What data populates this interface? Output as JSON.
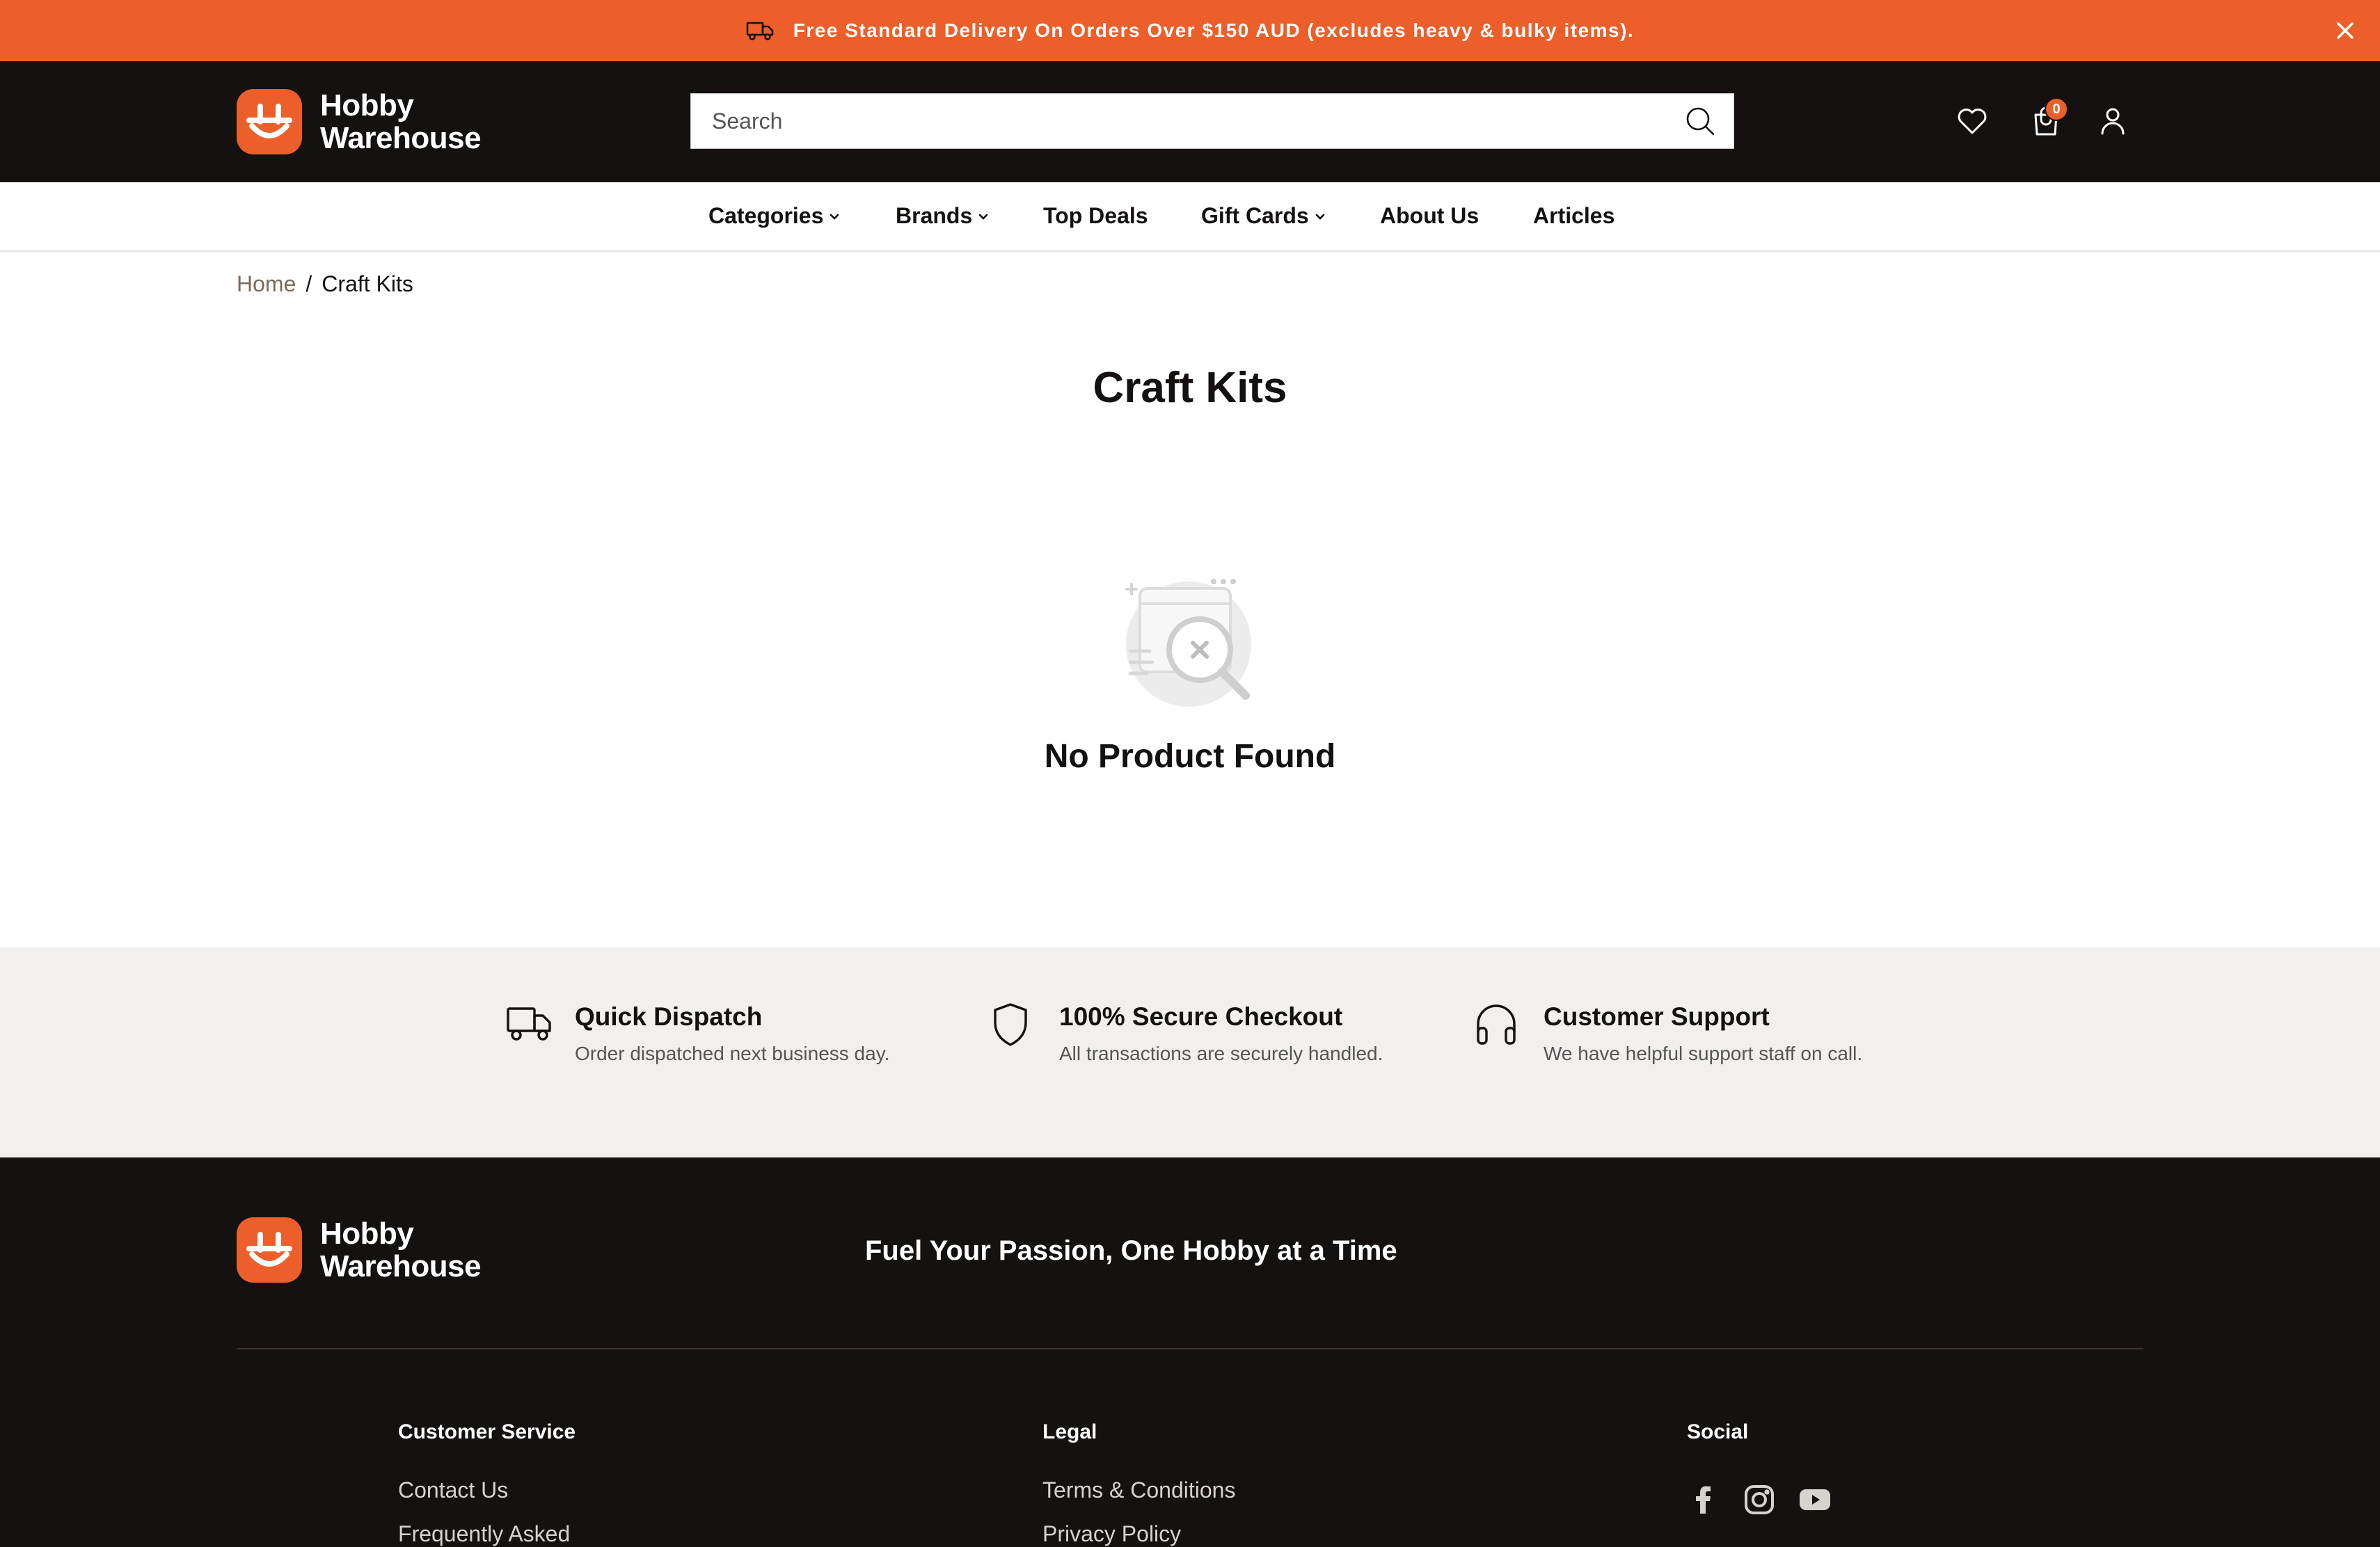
{
  "promo": {
    "text": "Free Standard Delivery On Orders Over $150 AUD (excludes heavy & bulky items)."
  },
  "brand": {
    "name_line1": "Hobby",
    "name_line2": "Warehouse",
    "accent_color": "#ec5f2a",
    "dark_color": "#141110"
  },
  "header": {
    "search_placeholder": "Search",
    "cart_count": "0"
  },
  "nav": {
    "items": [
      {
        "label": "Categories",
        "has_dropdown": true
      },
      {
        "label": "Brands",
        "has_dropdown": true
      },
      {
        "label": "Top Deals",
        "has_dropdown": false
      },
      {
        "label": "Gift Cards",
        "has_dropdown": true
      },
      {
        "label": "About Us",
        "has_dropdown": false
      },
      {
        "label": "Articles",
        "has_dropdown": false
      }
    ]
  },
  "breadcrumb": {
    "home": "Home",
    "separator": "/",
    "current": "Craft Kits"
  },
  "page": {
    "title": "Craft Kits",
    "empty_message": "No Product Found"
  },
  "features": [
    {
      "icon": "truck-icon",
      "title": "Quick Dispatch",
      "desc": "Order dispatched next business day."
    },
    {
      "icon": "shield-icon",
      "title": "100% Secure Checkout",
      "desc": "All transactions are securely handled."
    },
    {
      "icon": "headphones-icon",
      "title": "Customer Support",
      "desc": "We have helpful support staff on call."
    }
  ],
  "footer": {
    "tagline": "Fuel Your Passion, One Hobby at a Time",
    "columns": {
      "customer_service": {
        "title": "Customer Service",
        "links": [
          "Contact Us",
          "Frequently Asked"
        ]
      },
      "legal": {
        "title": "Legal",
        "links": [
          "Terms & Conditions",
          "Privacy Policy"
        ]
      },
      "social": {
        "title": "Social",
        "icons": [
          "facebook-icon",
          "instagram-icon",
          "youtube-icon"
        ]
      }
    }
  }
}
